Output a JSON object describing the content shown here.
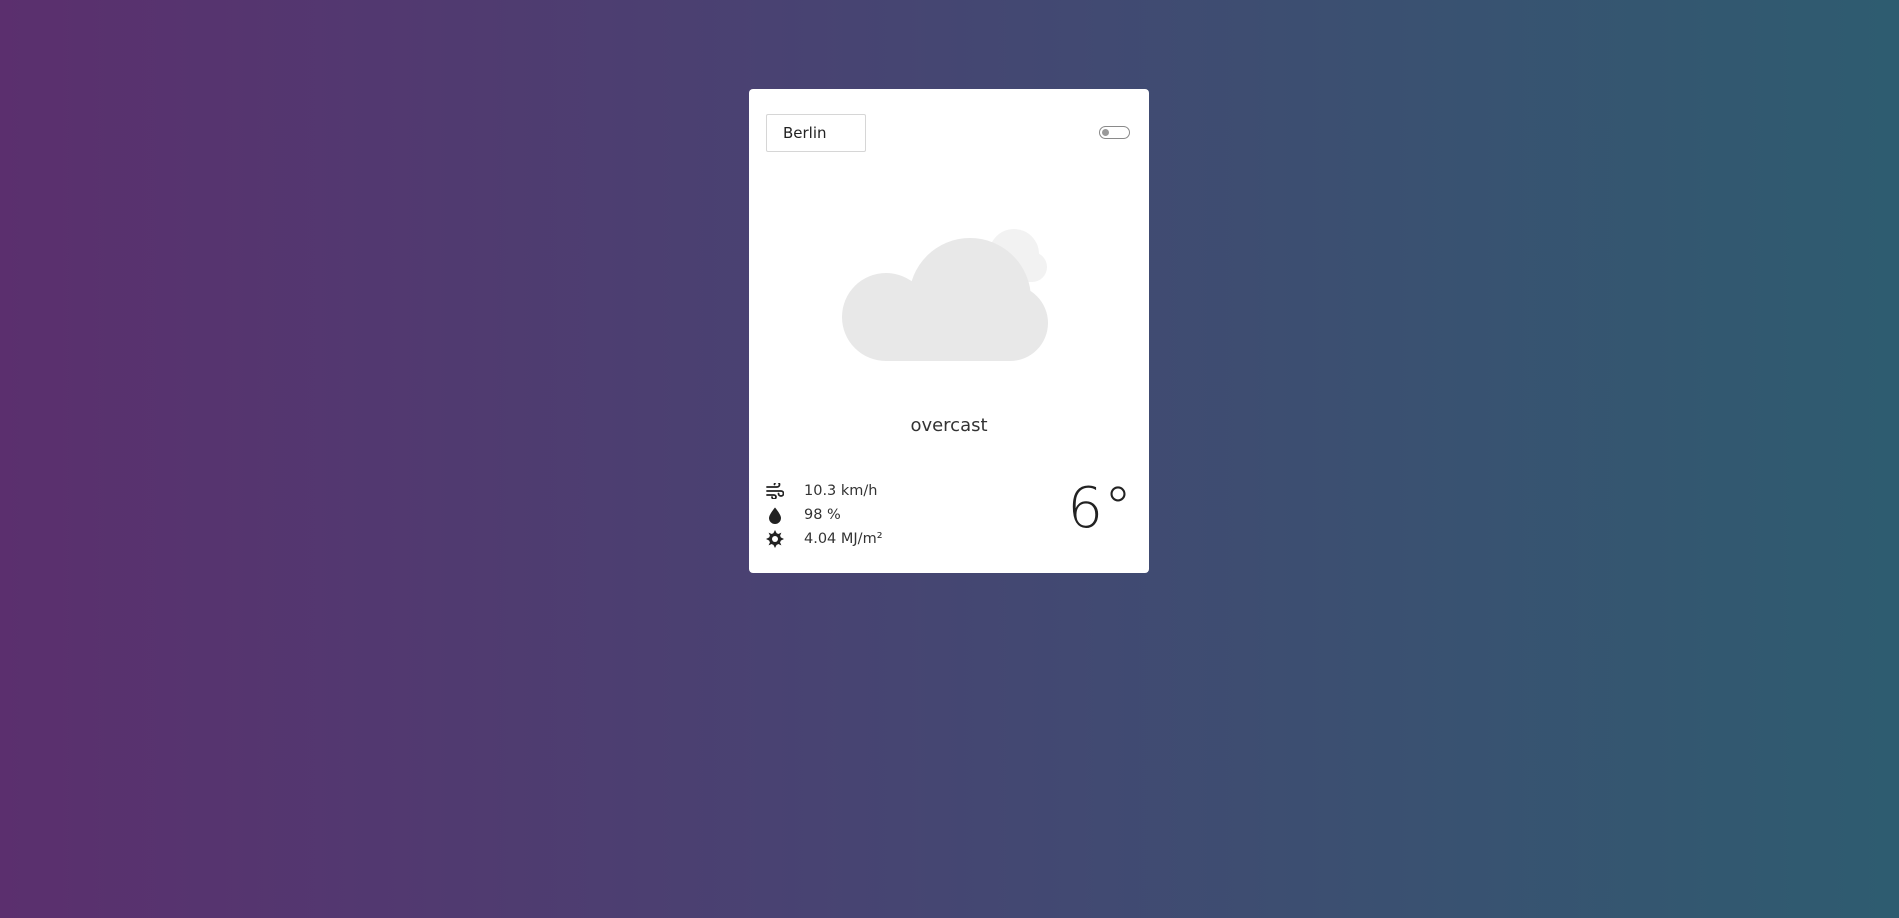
{
  "search": {
    "value": "Berlin"
  },
  "toggle": {
    "state": "off"
  },
  "weather": {
    "icon": "overcast-cloud-icon",
    "condition": "overcast",
    "temperature": "6°",
    "stats": [
      {
        "icon": "wind-icon",
        "value": "10.3 km/h"
      },
      {
        "icon": "humidity-drop-icon",
        "value": "98 %"
      },
      {
        "icon": "sun-radiation-icon",
        "value": "4.04 MJ/m²"
      }
    ]
  },
  "colors": {
    "cloud_main": "#e8e8e8",
    "cloud_back": "#f2f2f2",
    "card_bg": "#ffffff"
  }
}
